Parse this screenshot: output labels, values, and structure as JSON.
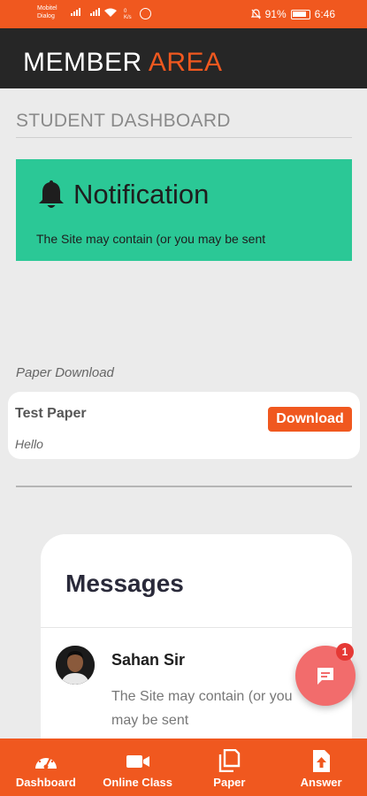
{
  "status_bar": {
    "carrier_line1": "Mobitel",
    "carrier_line2": "Dialog",
    "speed_value": "0",
    "speed_unit": "K/s",
    "battery": "91%",
    "time": "6:46"
  },
  "header": {
    "title_main": "MEMBER",
    "title_accent": "AREA"
  },
  "dashboard": {
    "title": "STUDENT DASHBOARD"
  },
  "notification": {
    "title": "Notification",
    "text": "The Site may contain (or you may be sent"
  },
  "paper_section": {
    "label": "Paper Download",
    "item": {
      "title": "Test Paper",
      "subtitle": "Hello",
      "button_label": "Download"
    }
  },
  "messages": {
    "title": "Messages",
    "items": [
      {
        "sender": "Sahan Sir",
        "text": "The Site may contain (or you may be sent"
      }
    ]
  },
  "chat_fab": {
    "badge": "1",
    "icon": "chat-bubble-icon"
  },
  "bottom_nav": {
    "items": [
      {
        "label": "Dashboard",
        "icon": "speedometer-icon"
      },
      {
        "label": "Online Class",
        "icon": "video-camera-icon"
      },
      {
        "label": "Paper",
        "icon": "copy-icon"
      },
      {
        "label": "Answer",
        "icon": "file-upload-icon"
      }
    ]
  },
  "colors": {
    "accent": "#f0581f",
    "header_bg": "#262626",
    "notification_bg": "#2bc896",
    "fab": "#f26c6c"
  }
}
